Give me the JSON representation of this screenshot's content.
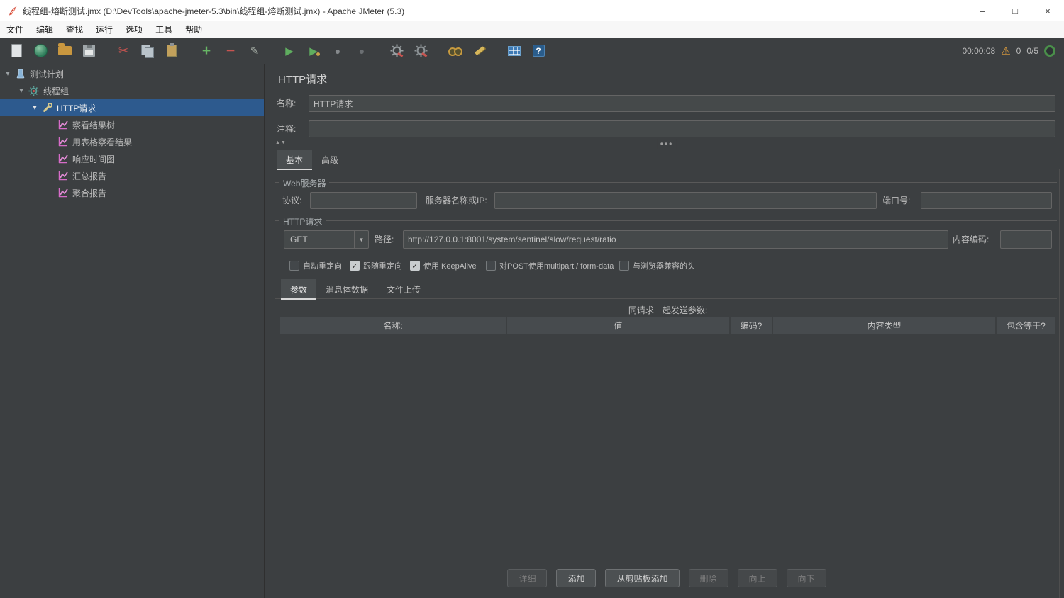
{
  "window": {
    "title": "线程组-熔断测试.jmx (D:\\DevTools\\apache-jmeter-5.3\\bin\\线程组-熔断测试.jmx) - Apache JMeter (5.3)"
  },
  "menubar": {
    "items": [
      {
        "label": "文件"
      },
      {
        "label": "编辑"
      },
      {
        "label": "查找"
      },
      {
        "label": "运行"
      },
      {
        "label": "选项"
      },
      {
        "label": "工具"
      },
      {
        "label": "帮助"
      }
    ]
  },
  "toolbar": {
    "timer": "00:00:08",
    "warning_count": "0",
    "thread_status": "0/5"
  },
  "tree": {
    "items": [
      {
        "label": "测试计划"
      },
      {
        "label": "线程组"
      },
      {
        "label": "HTTP请求",
        "selected": true
      },
      {
        "label": "察看结果树"
      },
      {
        "label": "用表格察看结果"
      },
      {
        "label": "响应时间图"
      },
      {
        "label": "汇总报告"
      },
      {
        "label": "聚合报告"
      }
    ]
  },
  "main": {
    "title": "HTTP请求",
    "name_label": "名称:",
    "name_value": "HTTP请求",
    "comment_label": "注释:",
    "comment_value": "",
    "tabs": [
      {
        "label": "基本"
      },
      {
        "label": "高级"
      }
    ],
    "webserver": {
      "group_title": "Web服务器",
      "protocol_label": "协议:",
      "protocol_value": "",
      "server_label": "服务器名称或IP:",
      "server_value": "",
      "port_label": "端口号:",
      "port_value": ""
    },
    "request": {
      "group_title": "HTTP请求",
      "method": "GET",
      "path_label": "路径:",
      "path_value": "http://127.0.0.1:8001/system/sentinel/slow/request/ratio",
      "encoding_label": "内容编码:",
      "encoding_value": "",
      "checkboxes": [
        {
          "label": "自动重定向",
          "checked": false
        },
        {
          "label": "跟随重定向",
          "checked": true
        },
        {
          "label": "使用 KeepAlive",
          "checked": true
        },
        {
          "label": "对POST使用multipart / form-data",
          "checked": false
        },
        {
          "label": "与浏览器兼容的头",
          "checked": false
        }
      ]
    },
    "params": {
      "tabs": [
        {
          "label": "参数"
        },
        {
          "label": "消息体数据"
        },
        {
          "label": "文件上传"
        }
      ],
      "table_title": "同请求一起发送参数:",
      "columns": [
        {
          "label": "名称:"
        },
        {
          "label": "值"
        },
        {
          "label": "编码?"
        },
        {
          "label": "内容类型"
        },
        {
          "label": "包含等于?"
        }
      ],
      "buttons": [
        {
          "label": "详细",
          "enabled": false
        },
        {
          "label": "添加",
          "enabled": true
        },
        {
          "label": "从剪贴板添加",
          "enabled": true
        },
        {
          "label": "删除",
          "enabled": false
        },
        {
          "label": "向上",
          "enabled": false
        },
        {
          "label": "向下",
          "enabled": false
        }
      ]
    }
  },
  "colors": {
    "panel_bg": "#3c3f41",
    "field_bg": "#45494a",
    "tree_selection": "#2d5a8e",
    "accent_green": "#5fad5f",
    "warning_yellow": "#e8a33d"
  },
  "icons": {
    "minimize": "–",
    "maximize": "□",
    "close": "×",
    "cut": "✂",
    "plus": "+",
    "minus": "−",
    "toggle": "✎",
    "play": "▶",
    "stop": "●",
    "warning": "⚠",
    "help": "?",
    "dropdown": "▼",
    "check": "✓",
    "divider_dots": "•••",
    "collapse_arrows": "▲▼",
    "splitter_dots": "⋮",
    "tree_arrow": "▾"
  }
}
